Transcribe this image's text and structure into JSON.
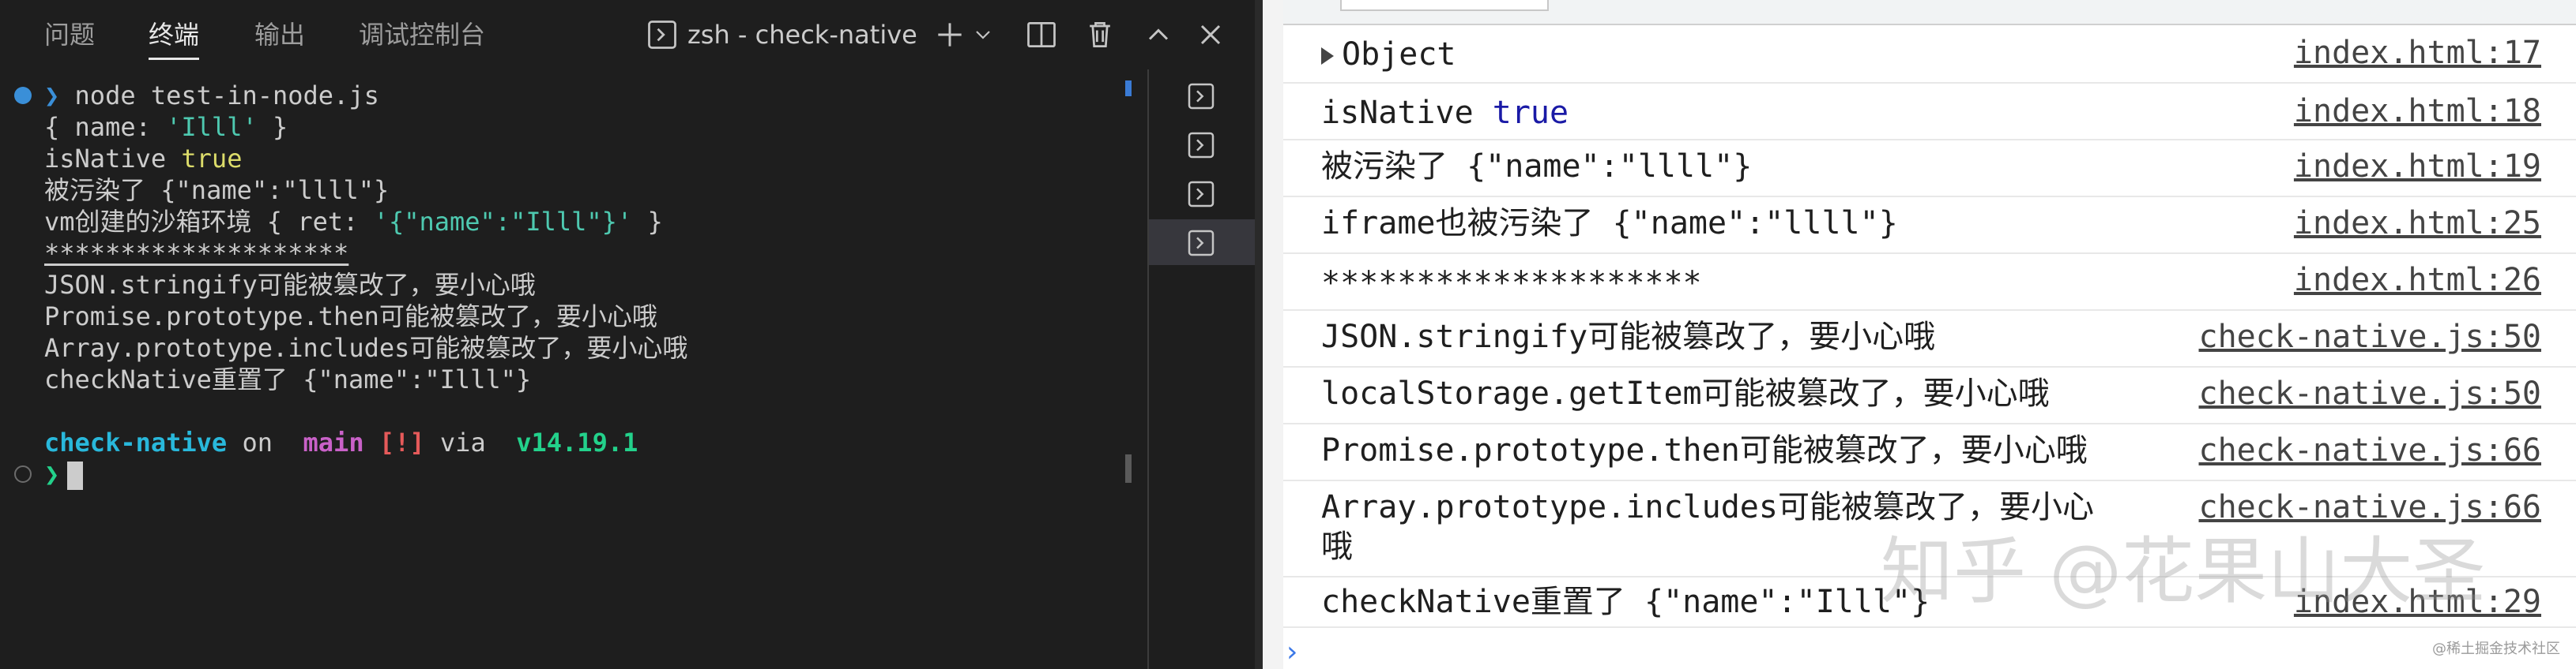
{
  "terminal_panel": {
    "tabs": [
      "问题",
      "终端",
      "输出",
      "调试控制台"
    ],
    "active_tab": "终端",
    "shell_label": "zsh - check-native",
    "toolbar_icons": [
      "terminal-icon",
      "plus-icon",
      "chevron-down-icon",
      "split-icon",
      "trash-icon",
      "chevron-up-icon",
      "close-icon"
    ],
    "lines": {
      "l0_prompt": "❯",
      "l0_cmd": " node test-in-node.js",
      "l1a": "{ name: ",
      "l1b": "'Illl'",
      "l1c": " }",
      "l2a": "isNative ",
      "l2b": "true",
      "l3": "被污染了 {\"name\":\"llll\"}",
      "l4a": "vm创建的沙箱环境 { ret: ",
      "l4b": "'{\"name\":\"Illl\"}'",
      "l4c": " }",
      "l5": "********************",
      "l6": "JSON.stringify可能被篡改了，要小心哦",
      "l7": "Promise.prototype.then可能被篡改了，要小心哦",
      "l8": "Array.prototype.includes可能被篡改了，要小心哦",
      "l9": "checkNative重置了 {\"name\":\"Illl\"}",
      "p_dir": "check-native",
      "p_on": " on ",
      "p_branch_icon": "",
      "p_branch": " main",
      "p_status": " [!]",
      "p_via": " via ",
      "p_node_icon": "",
      "p_version": " v14.19.1",
      "l12_prompt": "❯"
    },
    "side_terminals": 4,
    "colors": {
      "background": "#1e1e1e",
      "blue_dot": "#3a8fd8",
      "gray_dot": "#6b6b6b"
    }
  },
  "console": {
    "rows": [
      {
        "pre": "",
        "msg": "Object",
        "expandable": true,
        "source": "index.html:17"
      },
      {
        "pre": "isNative ",
        "msg": "true",
        "keyword": true,
        "source": "index.html:18"
      },
      {
        "pre": "",
        "msg": "被污染了 {\"name\":\"llll\"}",
        "source": "index.html:19"
      },
      {
        "pre": "",
        "msg": "iframe也被污染了 {\"name\":\"llll\"}",
        "source": "index.html:25"
      },
      {
        "pre": "",
        "msg": "********************",
        "source": "index.html:26"
      },
      {
        "pre": "",
        "msg": "JSON.stringify可能被篡改了，要小心哦",
        "source": "check-native.js:50"
      },
      {
        "pre": "",
        "msg": "localStorage.getItem可能被篡改了，要小心哦",
        "source": "check-native.js:50"
      },
      {
        "pre": "",
        "msg": "Promise.prototype.then可能被篡改了，要小心哦",
        "source": "check-native.js:66"
      },
      {
        "pre": "",
        "msg": "Array.prototype.includes可能被篡改了，要小心哦",
        "source": "check-native.js:66"
      },
      {
        "pre": "",
        "msg": "checkNative重置了 {\"name\":\"Illl\"}",
        "source": "index.html:29"
      }
    ],
    "prompt_symbol": "›",
    "watermark": "知乎 @花果山大圣",
    "juejin_tag": "@稀土掘金技术社区"
  }
}
